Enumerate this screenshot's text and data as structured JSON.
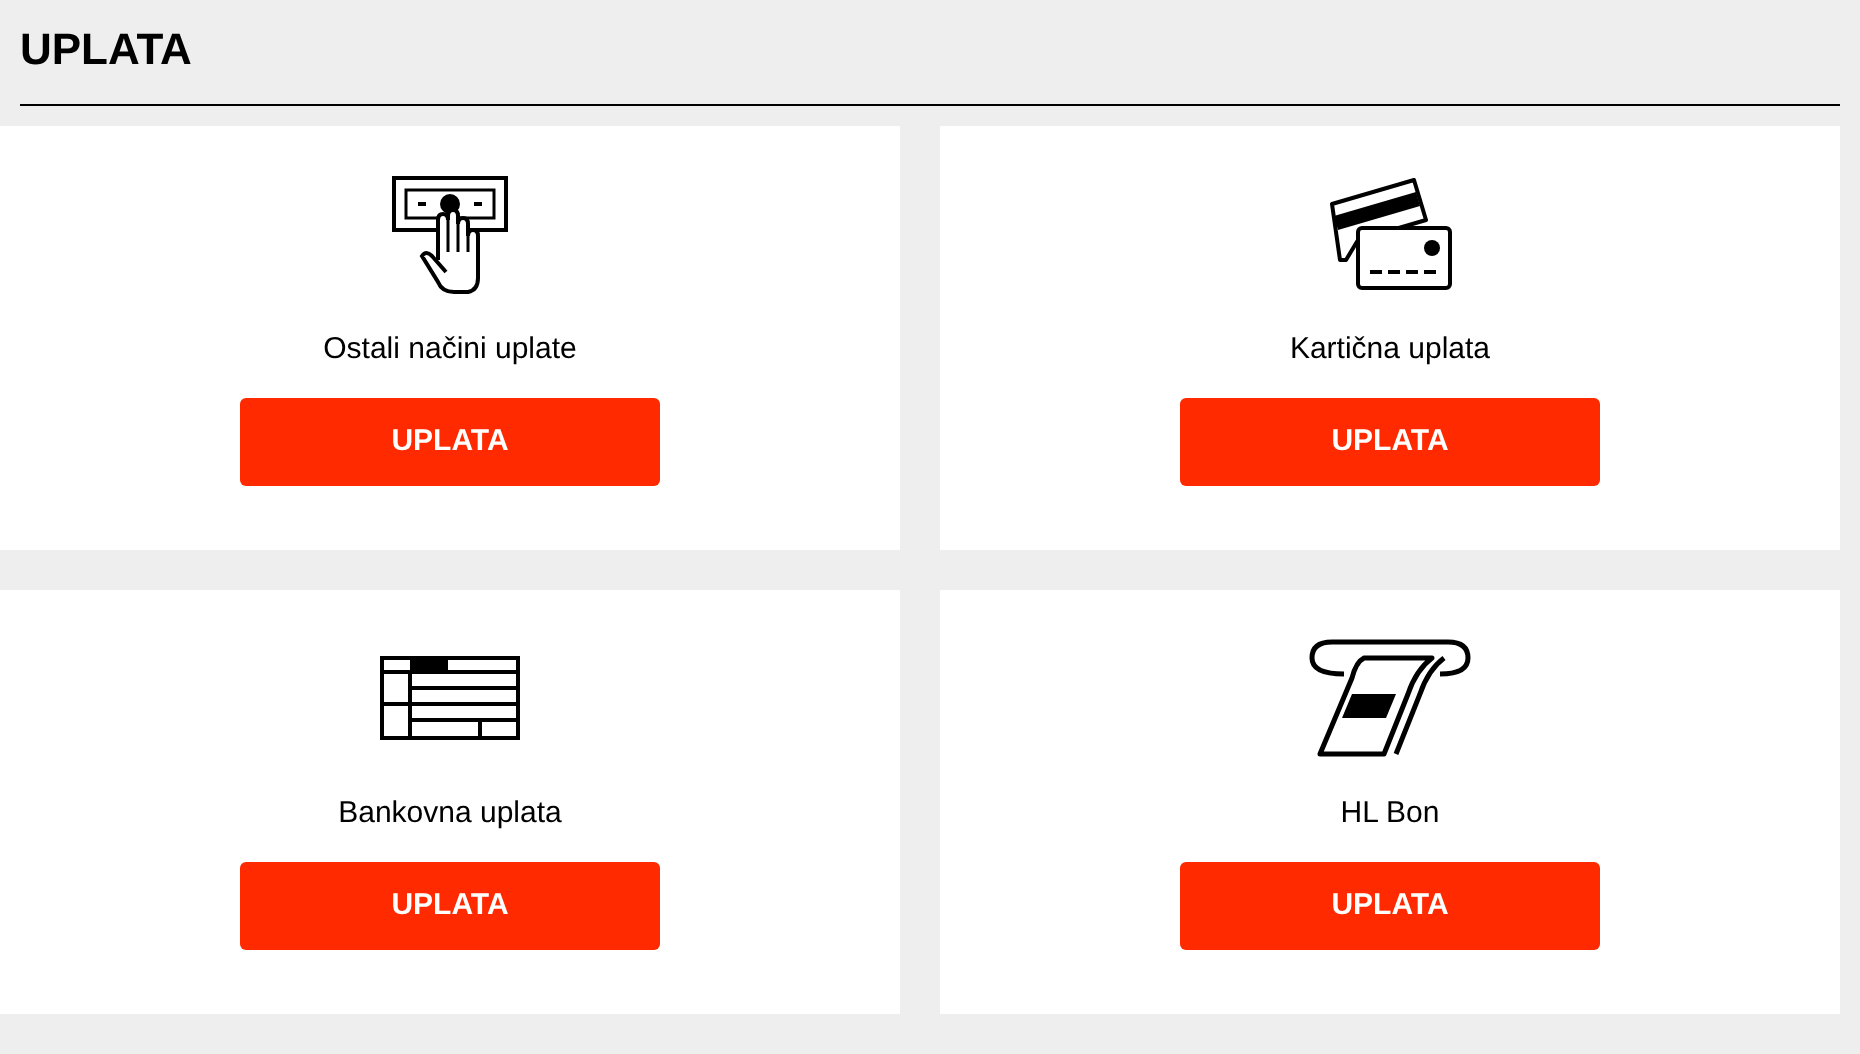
{
  "title": "UPLATA",
  "options": [
    {
      "kind": "cash",
      "label": "Ostali načini uplate",
      "button": "UPLATA"
    },
    {
      "kind": "card",
      "label": "Kartična uplata",
      "button": "UPLATA"
    },
    {
      "kind": "bank",
      "label": "Bankovna uplata",
      "button": "UPLATA"
    },
    {
      "kind": "voucher",
      "label": "HL Bon",
      "button": "UPLATA"
    }
  ]
}
